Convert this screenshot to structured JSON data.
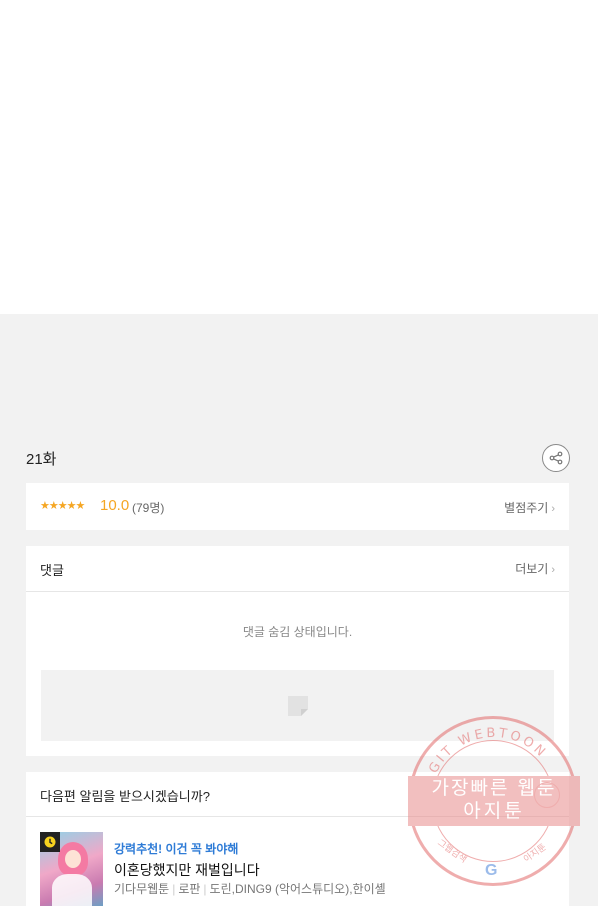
{
  "episode": {
    "title": "21화"
  },
  "rating": {
    "stars": "★★★★★",
    "score": "10.0",
    "voters": "(79명)",
    "rate_link": "별점주기"
  },
  "comments": {
    "title": "댓글",
    "more": "더보기",
    "hidden_message": "댓글 숨김 상태입니다."
  },
  "notify": {
    "question": "다음편 알림을 받으시겠습니까?"
  },
  "recommendation": {
    "tag": "강력추천! 이건 꼭 봐야해",
    "title": "이혼당했지만 재벌입니다",
    "platform": "기다무웹툰",
    "genre": "로판",
    "authors": "도린,DING9 (악어스튜디오),한이셸"
  },
  "watermark": {
    "ring_text": "AGIT WEBTOON",
    "line1": "가장빠른 웹툰",
    "line2": "아지툰",
    "left_small": "그웹검색",
    "right_small": "아지툰",
    "google_letter": "G"
  },
  "colors": {
    "accent_star": "#f5a623",
    "recommend_tag": "#2e7bd6",
    "watermark": "#e36b6b",
    "background": "#f2f2f2"
  }
}
